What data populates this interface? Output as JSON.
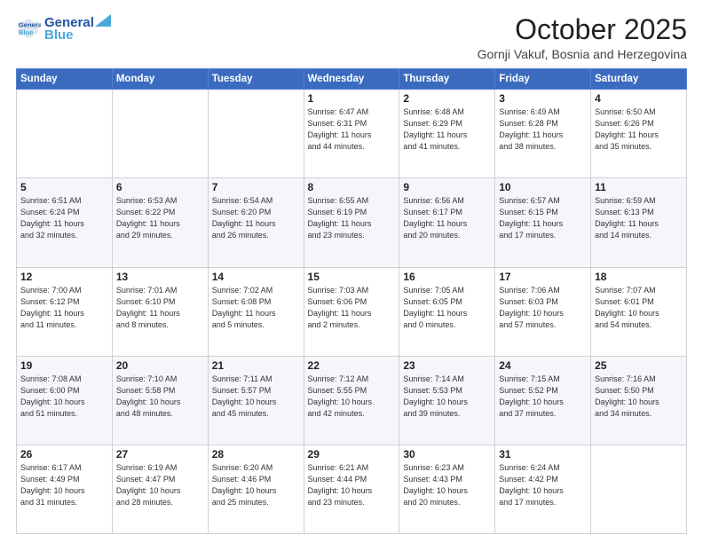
{
  "header": {
    "logo_line1": "General",
    "logo_line2": "Blue",
    "title": "October 2025",
    "subtitle": "Gornji Vakuf, Bosnia and Herzegovina"
  },
  "weekdays": [
    "Sunday",
    "Monday",
    "Tuesday",
    "Wednesday",
    "Thursday",
    "Friday",
    "Saturday"
  ],
  "weeks": [
    [
      {
        "day": "",
        "info": ""
      },
      {
        "day": "",
        "info": ""
      },
      {
        "day": "",
        "info": ""
      },
      {
        "day": "1",
        "info": "Sunrise: 6:47 AM\nSunset: 6:31 PM\nDaylight: 11 hours\nand 44 minutes."
      },
      {
        "day": "2",
        "info": "Sunrise: 6:48 AM\nSunset: 6:29 PM\nDaylight: 11 hours\nand 41 minutes."
      },
      {
        "day": "3",
        "info": "Sunrise: 6:49 AM\nSunset: 6:28 PM\nDaylight: 11 hours\nand 38 minutes."
      },
      {
        "day": "4",
        "info": "Sunrise: 6:50 AM\nSunset: 6:26 PM\nDaylight: 11 hours\nand 35 minutes."
      }
    ],
    [
      {
        "day": "5",
        "info": "Sunrise: 6:51 AM\nSunset: 6:24 PM\nDaylight: 11 hours\nand 32 minutes."
      },
      {
        "day": "6",
        "info": "Sunrise: 6:53 AM\nSunset: 6:22 PM\nDaylight: 11 hours\nand 29 minutes."
      },
      {
        "day": "7",
        "info": "Sunrise: 6:54 AM\nSunset: 6:20 PM\nDaylight: 11 hours\nand 26 minutes."
      },
      {
        "day": "8",
        "info": "Sunrise: 6:55 AM\nSunset: 6:19 PM\nDaylight: 11 hours\nand 23 minutes."
      },
      {
        "day": "9",
        "info": "Sunrise: 6:56 AM\nSunset: 6:17 PM\nDaylight: 11 hours\nand 20 minutes."
      },
      {
        "day": "10",
        "info": "Sunrise: 6:57 AM\nSunset: 6:15 PM\nDaylight: 11 hours\nand 17 minutes."
      },
      {
        "day": "11",
        "info": "Sunrise: 6:59 AM\nSunset: 6:13 PM\nDaylight: 11 hours\nand 14 minutes."
      }
    ],
    [
      {
        "day": "12",
        "info": "Sunrise: 7:00 AM\nSunset: 6:12 PM\nDaylight: 11 hours\nand 11 minutes."
      },
      {
        "day": "13",
        "info": "Sunrise: 7:01 AM\nSunset: 6:10 PM\nDaylight: 11 hours\nand 8 minutes."
      },
      {
        "day": "14",
        "info": "Sunrise: 7:02 AM\nSunset: 6:08 PM\nDaylight: 11 hours\nand 5 minutes."
      },
      {
        "day": "15",
        "info": "Sunrise: 7:03 AM\nSunset: 6:06 PM\nDaylight: 11 hours\nand 2 minutes."
      },
      {
        "day": "16",
        "info": "Sunrise: 7:05 AM\nSunset: 6:05 PM\nDaylight: 11 hours\nand 0 minutes."
      },
      {
        "day": "17",
        "info": "Sunrise: 7:06 AM\nSunset: 6:03 PM\nDaylight: 10 hours\nand 57 minutes."
      },
      {
        "day": "18",
        "info": "Sunrise: 7:07 AM\nSunset: 6:01 PM\nDaylight: 10 hours\nand 54 minutes."
      }
    ],
    [
      {
        "day": "19",
        "info": "Sunrise: 7:08 AM\nSunset: 6:00 PM\nDaylight: 10 hours\nand 51 minutes."
      },
      {
        "day": "20",
        "info": "Sunrise: 7:10 AM\nSunset: 5:58 PM\nDaylight: 10 hours\nand 48 minutes."
      },
      {
        "day": "21",
        "info": "Sunrise: 7:11 AM\nSunset: 5:57 PM\nDaylight: 10 hours\nand 45 minutes."
      },
      {
        "day": "22",
        "info": "Sunrise: 7:12 AM\nSunset: 5:55 PM\nDaylight: 10 hours\nand 42 minutes."
      },
      {
        "day": "23",
        "info": "Sunrise: 7:14 AM\nSunset: 5:53 PM\nDaylight: 10 hours\nand 39 minutes."
      },
      {
        "day": "24",
        "info": "Sunrise: 7:15 AM\nSunset: 5:52 PM\nDaylight: 10 hours\nand 37 minutes."
      },
      {
        "day": "25",
        "info": "Sunrise: 7:16 AM\nSunset: 5:50 PM\nDaylight: 10 hours\nand 34 minutes."
      }
    ],
    [
      {
        "day": "26",
        "info": "Sunrise: 6:17 AM\nSunset: 4:49 PM\nDaylight: 10 hours\nand 31 minutes."
      },
      {
        "day": "27",
        "info": "Sunrise: 6:19 AM\nSunset: 4:47 PM\nDaylight: 10 hours\nand 28 minutes."
      },
      {
        "day": "28",
        "info": "Sunrise: 6:20 AM\nSunset: 4:46 PM\nDaylight: 10 hours\nand 25 minutes."
      },
      {
        "day": "29",
        "info": "Sunrise: 6:21 AM\nSunset: 4:44 PM\nDaylight: 10 hours\nand 23 minutes."
      },
      {
        "day": "30",
        "info": "Sunrise: 6:23 AM\nSunset: 4:43 PM\nDaylight: 10 hours\nand 20 minutes."
      },
      {
        "day": "31",
        "info": "Sunrise: 6:24 AM\nSunset: 4:42 PM\nDaylight: 10 hours\nand 17 minutes."
      },
      {
        "day": "",
        "info": ""
      }
    ]
  ]
}
